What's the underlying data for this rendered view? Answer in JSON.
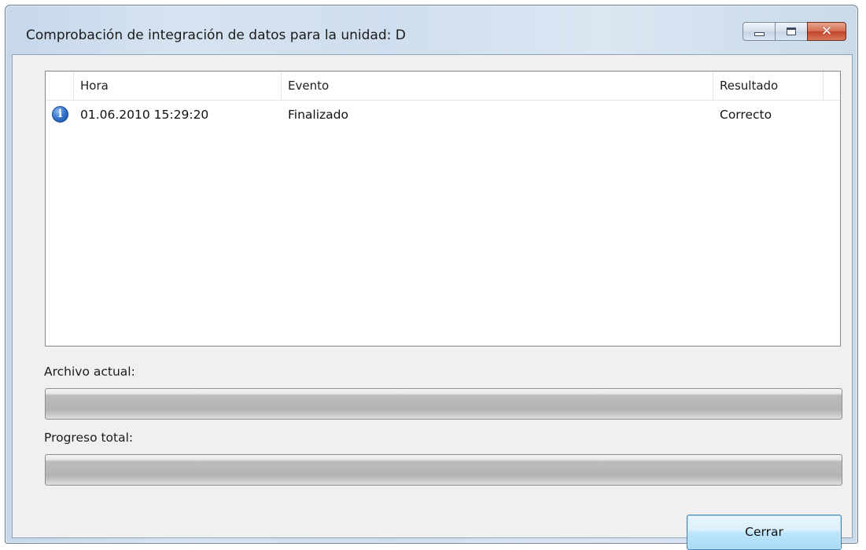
{
  "window": {
    "title": "Comprobación de integración de datos para la unidad: D",
    "controls": {
      "minimize": "minimize-icon",
      "maximize": "maximize-icon",
      "close": "close-icon"
    }
  },
  "log": {
    "columns": [
      "Hora",
      "Evento",
      "Resultado"
    ],
    "rows": [
      {
        "icon": "info-icon",
        "hora": "01.06.2010 15:29:20",
        "evento": "Finalizado",
        "resultado": "Correcto"
      }
    ]
  },
  "current_file": {
    "label": "Archivo actual:",
    "progress": 0
  },
  "total_progress": {
    "label": "Progreso total:",
    "progress": 0
  },
  "buttons": {
    "close_label": "Cerrar"
  },
  "colors": {
    "close_button": "#c2442a",
    "accent": "#3c7fb1"
  }
}
